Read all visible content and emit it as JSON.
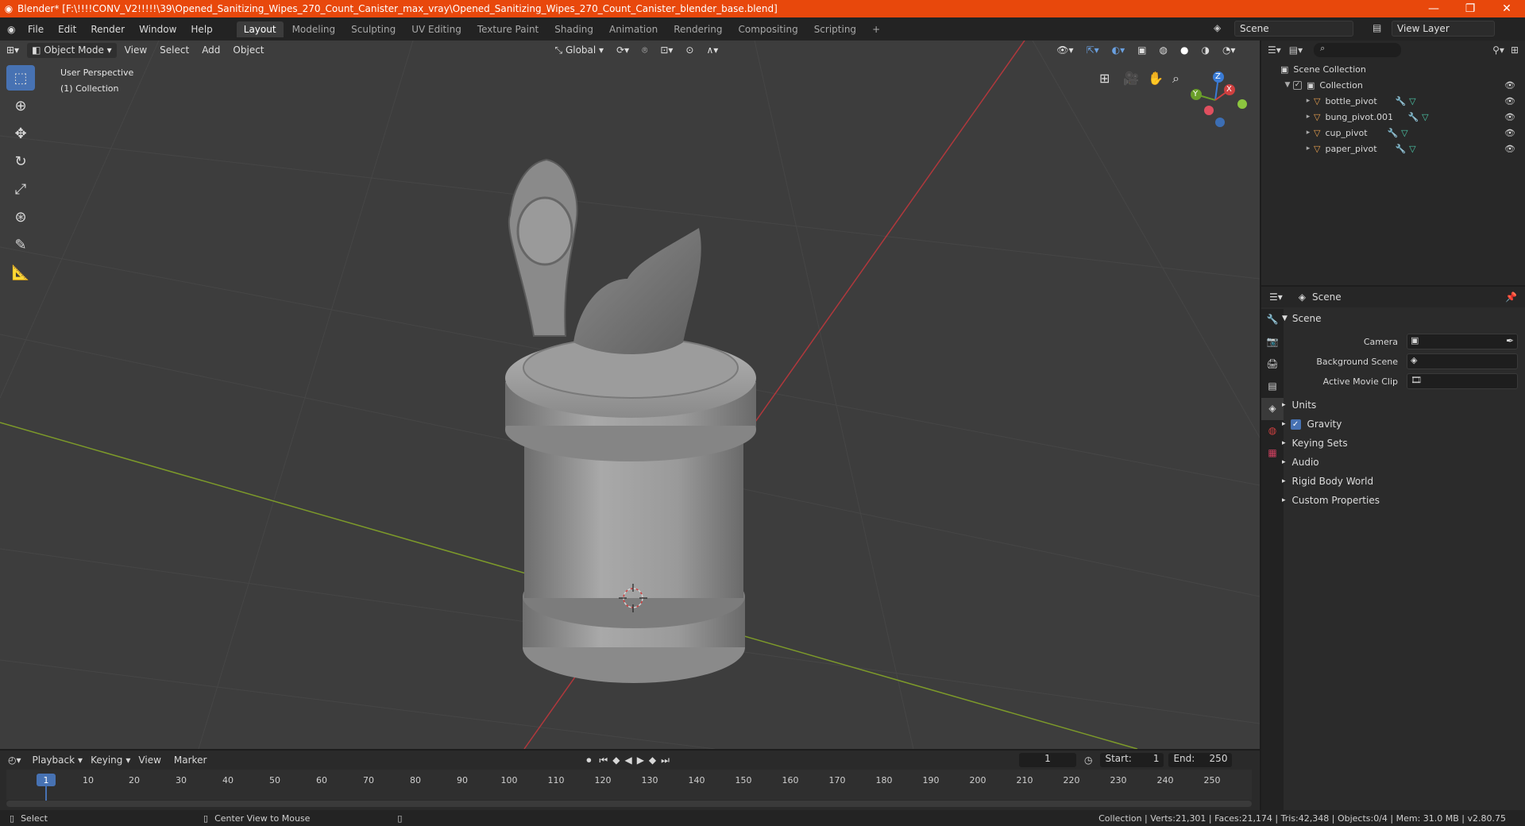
{
  "window": {
    "title": "Blender* [F:\\!!!!CONV_V2!!!!!\\39\\Opened_Sanitizing_Wipes_270_Count_Canister_max_vray\\Opened_Sanitizing_Wipes_270_Count_Canister_blender_base.blend]",
    "accent": "#e8480c"
  },
  "menubar": {
    "items": [
      "File",
      "Edit",
      "Render",
      "Window",
      "Help"
    ],
    "workspaces": [
      "Layout",
      "Modeling",
      "Sculpting",
      "UV Editing",
      "Texture Paint",
      "Shading",
      "Animation",
      "Rendering",
      "Compositing",
      "Scripting"
    ],
    "active_workspace": "Layout",
    "add_tab": "+",
    "scene": "Scene",
    "view_layer": "View Layer"
  },
  "viewport_header": {
    "mode": "Object Mode",
    "menus": [
      "View",
      "Select",
      "Add",
      "Object"
    ],
    "transform_orientation": "Global"
  },
  "viewport": {
    "perspective": "User Perspective",
    "collection": "(1) Collection",
    "gizmo_axes": [
      "Z",
      "Y",
      "X"
    ]
  },
  "outliner": {
    "root": "Scene Collection",
    "collection": "Collection",
    "objects": [
      "bottle_pivot",
      "bung_pivot.001",
      "cup_pivot",
      "paper_pivot"
    ]
  },
  "properties": {
    "context": "Scene",
    "panel_title": "Scene",
    "fields": [
      {
        "label": "Camera"
      },
      {
        "label": "Background Scene"
      },
      {
        "label": "Active Movie Clip"
      }
    ],
    "sections": [
      "Units",
      "Gravity",
      "Keying Sets",
      "Audio",
      "Rigid Body World",
      "Custom Properties"
    ],
    "gravity_checked": true
  },
  "timeline": {
    "menus": [
      "Playback",
      "Keying",
      "View",
      "Marker"
    ],
    "current_frame": "1",
    "start_label": "Start:",
    "start": "1",
    "end_label": "End:",
    "end": "250",
    "ticks": [
      "1",
      "10",
      "20",
      "30",
      "40",
      "50",
      "60",
      "70",
      "80",
      "90",
      "100",
      "110",
      "120",
      "130",
      "140",
      "150",
      "160",
      "170",
      "180",
      "190",
      "200",
      "210",
      "220",
      "230",
      "240",
      "250"
    ]
  },
  "statusbar": {
    "left_action": "Select",
    "middle_action": "Center View to Mouse",
    "stats": "Collection | Verts:21,301 | Faces:21,174 | Tris:42,348 | Objects:0/4 | Mem: 31.0 MB | v2.80.75"
  }
}
